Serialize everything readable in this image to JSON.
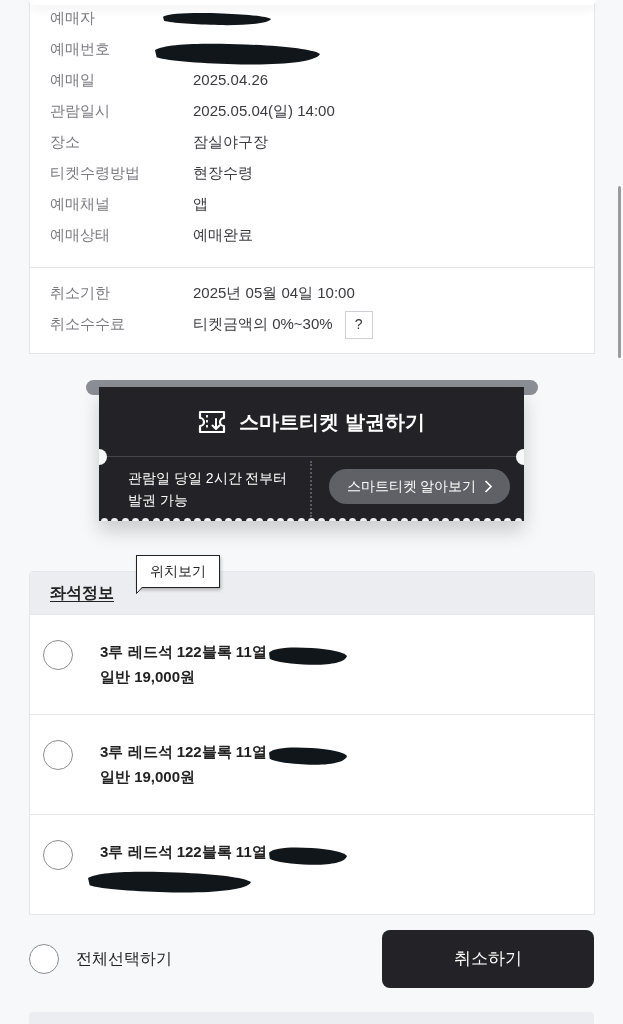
{
  "booking_info": {
    "rows": [
      {
        "label": "예매자",
        "redacted": true
      },
      {
        "label": "예매번호",
        "redacted": true
      },
      {
        "label": "예매일",
        "value": "2025.04.26",
        "redacted": false
      },
      {
        "label": "관람일시",
        "value": "2025.05.04(일) 14:00",
        "redacted": false
      },
      {
        "label": "장소",
        "value": "잠실야구장",
        "redacted": false
      },
      {
        "label": "티켓수령방법",
        "value": "현장수령",
        "redacted": false
      },
      {
        "label": "예매채널",
        "value": "앱",
        "redacted": false
      },
      {
        "label": "예매상태",
        "value": "예매완료",
        "redacted": false
      }
    ]
  },
  "cancel_info": {
    "rows": [
      {
        "label": "취소기한",
        "value": "2025년 05월 04일 10:00"
      },
      {
        "label": "취소수수료",
        "value": "티켓금액의 0%~30%",
        "help": "?"
      }
    ]
  },
  "smart_ticket": {
    "title": "스마트티켓 발권하기",
    "note": "관람일 당일 2시간 전부터 발권 가능",
    "button": "스마트티켓 알아보기"
  },
  "seat_info": {
    "title": "좌석정보",
    "tooltip": "위치보기",
    "seats": [
      {
        "seat": "3루 레드석 122블록 11열",
        "seat_redacted": true,
        "price": "일반 19,000원",
        "price_redacted": false,
        "selected": false
      },
      {
        "seat": "3루 레드석 122블록 11열",
        "seat_redacted": true,
        "price": "일반 19,000원",
        "price_redacted": false,
        "selected": false
      },
      {
        "seat": "3루 레드석 122블록 11열",
        "seat_redacted": true,
        "price_redacted": true,
        "selected": false
      }
    ]
  },
  "select_all": {
    "label": "전체선택하기",
    "checked": false
  },
  "cancel_button": "취소하기"
}
